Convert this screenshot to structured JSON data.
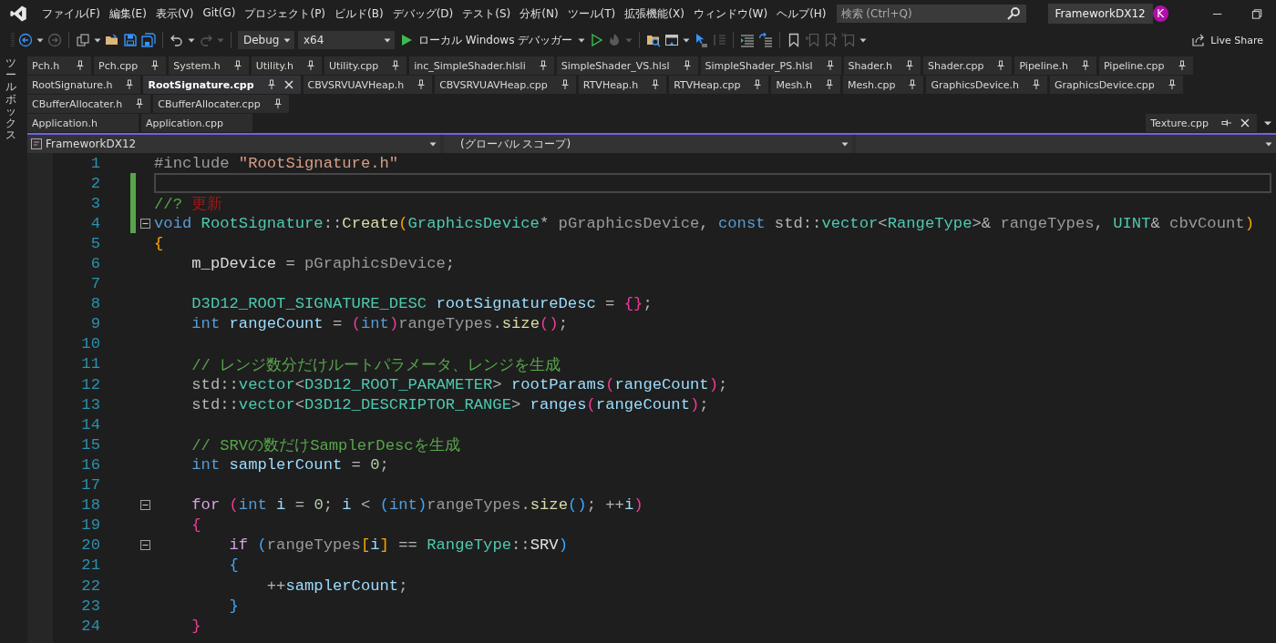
{
  "menu": [
    "ファイル(F)",
    "編集(E)",
    "表示(V)",
    "Git(G)",
    "プロジェクト(P)",
    "ビルド(B)",
    "デバッグ(D)",
    "テスト(S)",
    "分析(N)",
    "ツール(T)",
    "拡張機能(X)",
    "ウィンドウ(W)",
    "ヘルプ(H)"
  ],
  "search": {
    "placeholder": "検索 (Ctrl+Q)"
  },
  "solution_name": "FrameworkDX12",
  "avatar": "K",
  "toolbar": {
    "items": [
      {
        "kind": "back",
        "disabled": false
      },
      {
        "kind": "caret",
        "disabled": false
      },
      {
        "kind": "forward",
        "disabled": true
      },
      {
        "kind": "separator"
      },
      {
        "kind": "new-item",
        "disabled": false
      },
      {
        "kind": "caret",
        "disabled": false
      },
      {
        "kind": "open",
        "disabled": false
      },
      {
        "kind": "save",
        "disabled": false
      },
      {
        "kind": "save-all",
        "disabled": false
      },
      {
        "kind": "separator"
      },
      {
        "kind": "undo",
        "disabled": false
      },
      {
        "kind": "caret",
        "disabled": false
      },
      {
        "kind": "redo",
        "disabled": true
      },
      {
        "kind": "caret",
        "disabled": true
      },
      {
        "kind": "separator"
      },
      {
        "kind": "combo",
        "value": "Debug",
        "wide": false
      },
      {
        "kind": "combo",
        "value": "x64",
        "wide": true
      },
      {
        "kind": "run",
        "label": "ローカル Windows デバッガー"
      },
      {
        "kind": "caret",
        "disabled": false
      },
      {
        "kind": "run-outline",
        "disabled": false
      },
      {
        "kind": "flame",
        "disabled": true
      },
      {
        "kind": "caret",
        "disabled": true
      },
      {
        "kind": "separator"
      },
      {
        "kind": "folder-search",
        "disabled": false
      },
      {
        "kind": "window",
        "disabled": false
      },
      {
        "kind": "caret",
        "disabled": false
      },
      {
        "kind": "pointer",
        "disabled": false
      },
      {
        "kind": "step",
        "disabled": true
      },
      {
        "kind": "separator"
      },
      {
        "kind": "lines",
        "disabled": false
      },
      {
        "kind": "lines-arrow",
        "disabled": false
      },
      {
        "kind": "separator"
      },
      {
        "kind": "bookmark",
        "disabled": false
      },
      {
        "kind": "bookmark-prev",
        "disabled": true
      },
      {
        "kind": "bookmark-next",
        "disabled": true
      },
      {
        "kind": "bookmark-clear",
        "disabled": true
      },
      {
        "kind": "caret",
        "disabled": false
      }
    ],
    "live_share": "Live Share"
  },
  "toolbox": "ツールボックス",
  "tab_rows": [
    {
      "tabs": [
        {
          "label": "Pch.h",
          "pinned": true,
          "selected": false,
          "closable": false
        },
        {
          "label": "Pch.cpp",
          "pinned": true,
          "selected": false,
          "closable": false
        },
        {
          "label": "System.h",
          "pinned": true,
          "selected": false,
          "closable": false
        },
        {
          "label": "Utility.h",
          "pinned": true,
          "selected": false,
          "closable": false
        },
        {
          "label": "Utility.cpp",
          "pinned": true,
          "selected": false,
          "closable": false
        },
        {
          "label": "inc_SimpleShader.hlsli",
          "pinned": true,
          "selected": false,
          "closable": false
        },
        {
          "label": "SimpleShader_VS.hlsl",
          "pinned": true,
          "selected": false,
          "closable": false
        },
        {
          "label": "SimpleShader_PS.hlsl",
          "pinned": true,
          "selected": false,
          "closable": false
        },
        {
          "label": "Shader.h",
          "pinned": true,
          "selected": false,
          "closable": false
        },
        {
          "label": "Shader.cpp",
          "pinned": true,
          "selected": false,
          "closable": false
        },
        {
          "label": "Pipeline.h",
          "pinned": true,
          "selected": false,
          "closable": false
        },
        {
          "label": "Pipeline.cpp",
          "pinned": true,
          "selected": false,
          "closable": false
        }
      ]
    },
    {
      "tabs": [
        {
          "label": "RootSignature.h",
          "pinned": true,
          "selected": false,
          "closable": false
        },
        {
          "label": "RootSignature.cpp",
          "pinned": true,
          "selected": true,
          "closable": true
        },
        {
          "label": "CBVSRVUAVHeap.h",
          "pinned": true,
          "selected": false,
          "closable": false
        },
        {
          "label": "CBVSRVUAVHeap.cpp",
          "pinned": true,
          "selected": false,
          "closable": false
        },
        {
          "label": "RTVHeap.h",
          "pinned": true,
          "selected": false,
          "closable": false
        },
        {
          "label": "RTVHeap.cpp",
          "pinned": true,
          "selected": false,
          "closable": false
        },
        {
          "label": "Mesh.h",
          "pinned": true,
          "selected": false,
          "closable": false
        },
        {
          "label": "Mesh.cpp",
          "pinned": true,
          "selected": false,
          "closable": false
        },
        {
          "label": "GraphicsDevice.h",
          "pinned": true,
          "selected": false,
          "closable": false
        },
        {
          "label": "GraphicsDevice.cpp",
          "pinned": true,
          "selected": false,
          "closable": false
        }
      ]
    },
    {
      "tabs": [
        {
          "label": "CBufferAllocater.h",
          "pinned": true,
          "selected": false,
          "closable": false
        },
        {
          "label": "CBufferAllocater.cpp",
          "pinned": true,
          "selected": false,
          "closable": false
        }
      ]
    },
    {
      "tabs": [
        {
          "label": "Application.h",
          "pinned": false,
          "selected": false,
          "closable": false
        },
        {
          "label": "Application.cpp",
          "pinned": false,
          "selected": false,
          "closable": false
        }
      ],
      "end_tabs": [
        {
          "label": "Texture.cpp",
          "pinned": false,
          "selected": false,
          "closable": true
        }
      ]
    }
  ],
  "navigation": {
    "project": "FrameworkDX12",
    "scope": "(グローバル スコープ)"
  },
  "code": {
    "lines": [
      {
        "number": "1",
        "changed": false,
        "collapsible": false,
        "current": false,
        "tokens": [
          {
            "kind": "preproc",
            "text": "#include "
          },
          {
            "kind": "string",
            "text": "\"RootSignature.h\""
          }
        ]
      },
      {
        "number": "2",
        "changed": true,
        "collapsible": false,
        "current": true
      },
      {
        "number": "3",
        "changed": true,
        "collapsible": false,
        "current": false,
        "tokens": [
          {
            "kind": "comment",
            "text": "//? "
          },
          {
            "kind": "todo",
            "text": "更新"
          }
        ]
      },
      {
        "number": "4",
        "changed": true,
        "collapsible": true,
        "current": false,
        "tokens": [
          {
            "kind": "keyword",
            "text": "void "
          },
          {
            "kind": "type",
            "text": "RootSignature"
          },
          {
            "kind": "plain",
            "text": "::"
          },
          {
            "kind": "function",
            "text": "Create"
          },
          {
            "kind": "brace1",
            "text": "("
          },
          {
            "kind": "type",
            "text": "GraphicsDevice"
          },
          {
            "kind": "plain",
            "text": "* "
          },
          {
            "kind": "param",
            "text": "pGraphicsDevice"
          },
          {
            "kind": "plain",
            "text": ", "
          },
          {
            "kind": "keyword",
            "text": "const "
          },
          {
            "kind": "plain",
            "text": "std::"
          },
          {
            "kind": "type",
            "text": "vector"
          },
          {
            "kind": "plain",
            "text": "<"
          },
          {
            "kind": "type",
            "text": "RangeType"
          },
          {
            "kind": "plain",
            "text": ">& "
          },
          {
            "kind": "param",
            "text": "rangeTypes"
          },
          {
            "kind": "plain",
            "text": ", "
          },
          {
            "kind": "type",
            "text": "UINT"
          },
          {
            "kind": "plain",
            "text": "& "
          },
          {
            "kind": "param",
            "text": "cbvCount"
          },
          {
            "kind": "brace1",
            "text": ")"
          }
        ]
      },
      {
        "number": "5",
        "changed": false,
        "collapsible": false,
        "current": false,
        "tokens": [
          {
            "kind": "brace1",
            "text": "{"
          }
        ]
      },
      {
        "number": "6",
        "changed": false,
        "collapsible": false,
        "current": false,
        "tokens": [
          {
            "kind": "member",
            "text": "    m_pDevice"
          },
          {
            "kind": "plain",
            "text": " = "
          },
          {
            "kind": "param",
            "text": "pGraphicsDevice"
          },
          {
            "kind": "plain",
            "text": ";"
          }
        ]
      },
      {
        "number": "7",
        "changed": false,
        "collapsible": false,
        "current": false
      },
      {
        "number": "8",
        "changed": false,
        "collapsible": false,
        "current": false,
        "tokens": [
          {
            "kind": "type",
            "text": "    D3D12_ROOT_SIGNATURE_DESC "
          },
          {
            "kind": "local",
            "text": "rootSignatureDesc"
          },
          {
            "kind": "plain",
            "text": " = "
          },
          {
            "kind": "brace2",
            "text": "{}"
          },
          {
            "kind": "plain",
            "text": ";"
          }
        ]
      },
      {
        "number": "9",
        "changed": false,
        "collapsible": false,
        "current": false,
        "tokens": [
          {
            "kind": "keyword",
            "text": "    int "
          },
          {
            "kind": "local",
            "text": "rangeCount"
          },
          {
            "kind": "plain",
            "text": " = "
          },
          {
            "kind": "brace2",
            "text": "("
          },
          {
            "kind": "keyword",
            "text": "int"
          },
          {
            "kind": "brace2",
            "text": ")"
          },
          {
            "kind": "param",
            "text": "rangeTypes"
          },
          {
            "kind": "plain",
            "text": "."
          },
          {
            "kind": "function",
            "text": "size"
          },
          {
            "kind": "brace2",
            "text": "()"
          },
          {
            "kind": "plain",
            "text": ";"
          }
        ]
      },
      {
        "number": "10",
        "changed": false,
        "collapsible": false,
        "current": false
      },
      {
        "number": "11",
        "changed": false,
        "collapsible": false,
        "current": false,
        "tokens": [
          {
            "kind": "comment",
            "text": "    // レンジ数分だけルートパラメータ、レンジを生成"
          }
        ]
      },
      {
        "number": "12",
        "changed": false,
        "collapsible": false,
        "current": false,
        "tokens": [
          {
            "kind": "plain",
            "text": "    std::"
          },
          {
            "kind": "type",
            "text": "vector"
          },
          {
            "kind": "plain",
            "text": "<"
          },
          {
            "kind": "type",
            "text": "D3D12_ROOT_PARAMETER"
          },
          {
            "kind": "plain",
            "text": "> "
          },
          {
            "kind": "local",
            "text": "rootParams"
          },
          {
            "kind": "brace2",
            "text": "("
          },
          {
            "kind": "local",
            "text": "rangeCount"
          },
          {
            "kind": "brace2",
            "text": ")"
          },
          {
            "kind": "plain",
            "text": ";"
          }
        ]
      },
      {
        "number": "13",
        "changed": false,
        "collapsible": false,
        "current": false,
        "tokens": [
          {
            "kind": "plain",
            "text": "    std::"
          },
          {
            "kind": "type",
            "text": "vector"
          },
          {
            "kind": "plain",
            "text": "<"
          },
          {
            "kind": "type",
            "text": "D3D12_DESCRIPTOR_RANGE"
          },
          {
            "kind": "plain",
            "text": "> "
          },
          {
            "kind": "local",
            "text": "ranges"
          },
          {
            "kind": "brace2",
            "text": "("
          },
          {
            "kind": "local",
            "text": "rangeCount"
          },
          {
            "kind": "brace2",
            "text": ")"
          },
          {
            "kind": "plain",
            "text": ";"
          }
        ]
      },
      {
        "number": "14",
        "changed": false,
        "collapsible": false,
        "current": false
      },
      {
        "number": "15",
        "changed": false,
        "collapsible": false,
        "current": false,
        "tokens": [
          {
            "kind": "comment",
            "text": "    // SRVの数だけSamplerDescを生成"
          }
        ]
      },
      {
        "number": "16",
        "changed": false,
        "collapsible": false,
        "current": false,
        "tokens": [
          {
            "kind": "keyword",
            "text": "    int "
          },
          {
            "kind": "local",
            "text": "samplerCount"
          },
          {
            "kind": "plain",
            "text": " = "
          },
          {
            "kind": "number",
            "text": "0"
          },
          {
            "kind": "plain",
            "text": ";"
          }
        ]
      },
      {
        "number": "17",
        "changed": false,
        "collapsible": false,
        "current": false
      },
      {
        "number": "18",
        "changed": false,
        "collapsible": true,
        "current": false,
        "tokens": [
          {
            "kind": "control",
            "text": "    for "
          },
          {
            "kind": "brace2",
            "text": "("
          },
          {
            "kind": "keyword",
            "text": "int "
          },
          {
            "kind": "local",
            "text": "i"
          },
          {
            "kind": "plain",
            "text": " = "
          },
          {
            "kind": "number",
            "text": "0"
          },
          {
            "kind": "plain",
            "text": "; "
          },
          {
            "kind": "local",
            "text": "i"
          },
          {
            "kind": "plain",
            "text": " < "
          },
          {
            "kind": "brace3",
            "text": "("
          },
          {
            "kind": "keyword",
            "text": "int"
          },
          {
            "kind": "brace3",
            "text": ")"
          },
          {
            "kind": "param",
            "text": "rangeTypes"
          },
          {
            "kind": "plain",
            "text": "."
          },
          {
            "kind": "function",
            "text": "size"
          },
          {
            "kind": "brace3",
            "text": "()"
          },
          {
            "kind": "plain",
            "text": "; ++"
          },
          {
            "kind": "local",
            "text": "i"
          },
          {
            "kind": "brace2",
            "text": ")"
          }
        ]
      },
      {
        "number": "19",
        "changed": false,
        "collapsible": false,
        "current": false,
        "tokens": [
          {
            "kind": "brace2",
            "text": "    {"
          }
        ]
      },
      {
        "number": "20",
        "changed": false,
        "collapsible": true,
        "current": false,
        "tokens": [
          {
            "kind": "control",
            "text": "        if "
          },
          {
            "kind": "brace3",
            "text": "("
          },
          {
            "kind": "param",
            "text": "rangeTypes"
          },
          {
            "kind": "brace1",
            "text": "["
          },
          {
            "kind": "local",
            "text": "i"
          },
          {
            "kind": "brace1",
            "text": "]"
          },
          {
            "kind": "plain",
            "text": " == "
          },
          {
            "kind": "type",
            "text": "RangeType"
          },
          {
            "kind": "plain",
            "text": "::"
          },
          {
            "kind": "enum",
            "text": "SRV"
          },
          {
            "kind": "brace3",
            "text": ")"
          }
        ]
      },
      {
        "number": "21",
        "changed": false,
        "collapsible": false,
        "current": false,
        "tokens": [
          {
            "kind": "brace3",
            "text": "        {"
          }
        ]
      },
      {
        "number": "22",
        "changed": false,
        "collapsible": false,
        "current": false,
        "tokens": [
          {
            "kind": "plain",
            "text": "            ++"
          },
          {
            "kind": "local",
            "text": "samplerCount"
          },
          {
            "kind": "plain",
            "text": ";"
          }
        ]
      },
      {
        "number": "23",
        "changed": false,
        "collapsible": false,
        "current": false,
        "tokens": [
          {
            "kind": "brace3",
            "text": "        }"
          }
        ]
      },
      {
        "number": "24",
        "changed": false,
        "collapsible": false,
        "current": false,
        "tokens": [
          {
            "kind": "brace2",
            "text": "    }"
          }
        ]
      }
    ]
  }
}
